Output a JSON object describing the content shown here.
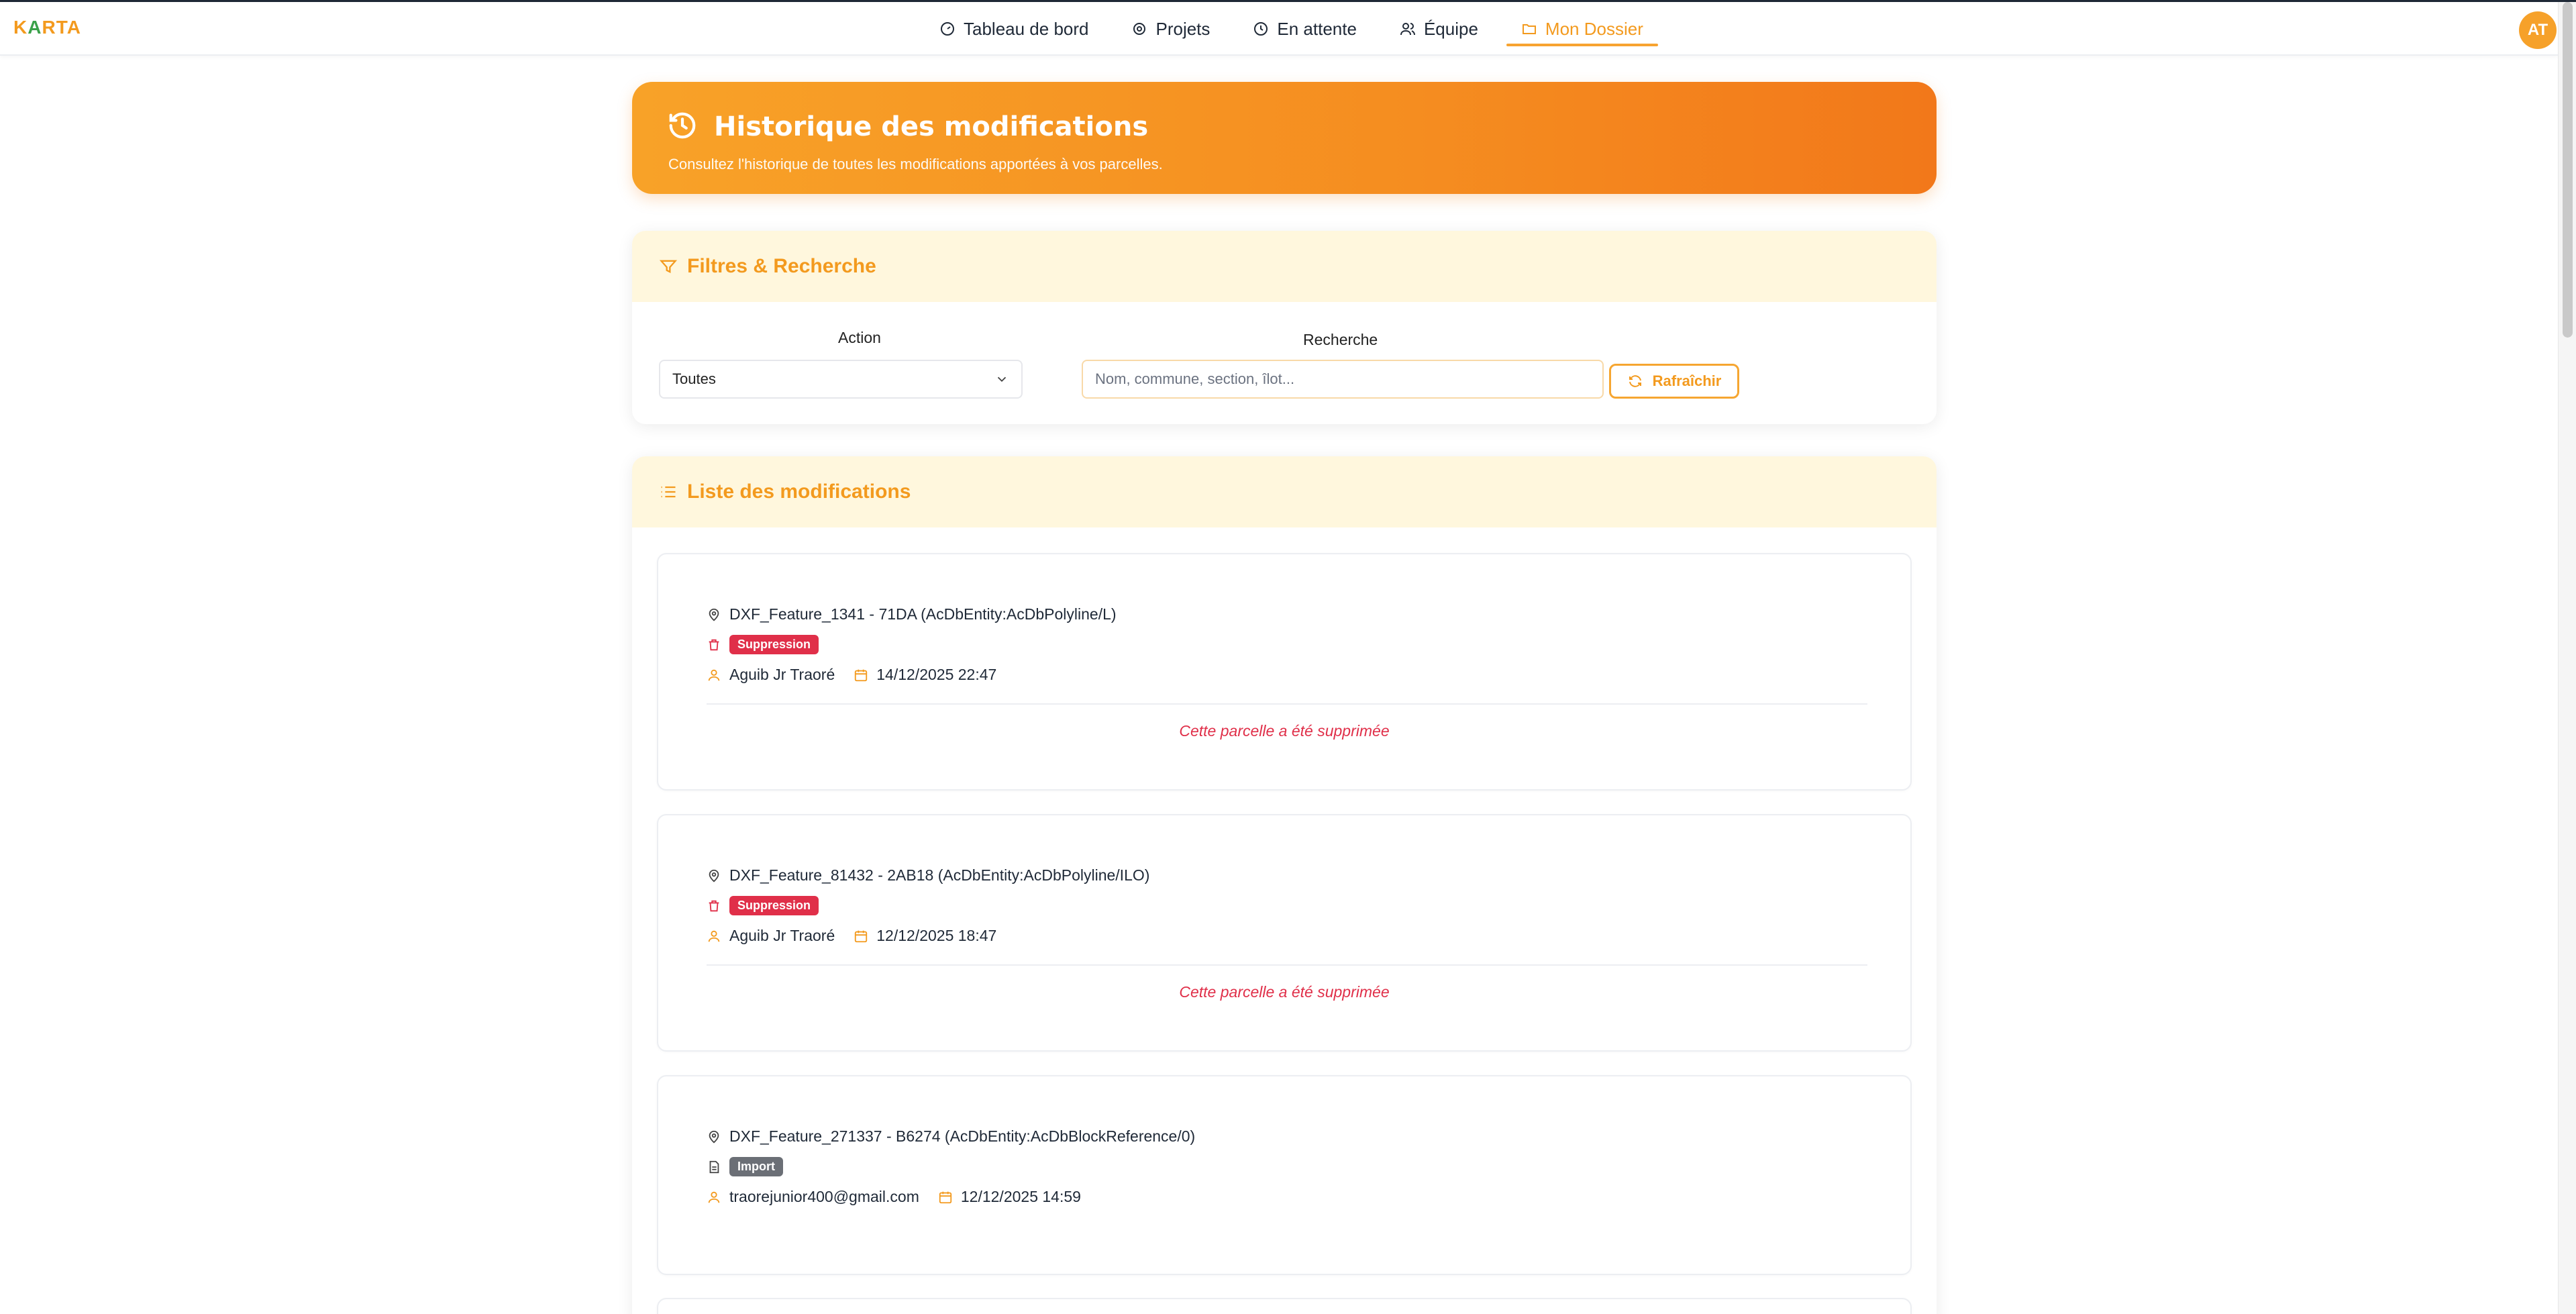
{
  "app": {
    "logo_pre": "K",
    "logo_mid": "A",
    "logo_post": "RTA",
    "avatar_initials": "AT"
  },
  "nav": [
    {
      "label": "Tableau de bord",
      "icon": "gauge-icon"
    },
    {
      "label": "Projets",
      "icon": "map-pin-icon"
    },
    {
      "label": "En attente",
      "icon": "clock-icon"
    },
    {
      "label": "Équipe",
      "icon": "users-icon"
    },
    {
      "label": "Mon Dossier",
      "icon": "folder-icon",
      "active": true
    }
  ],
  "hero": {
    "title": "Historique des modifications",
    "subtitle": "Consultez l'historique de toutes les modifications apportées à vos parcelles."
  },
  "filters": {
    "title": "Filtres & Recherche",
    "action_label": "Action",
    "action_value": "Toutes",
    "search_label": "Recherche",
    "search_placeholder": "Nom, commune, section, îlot...",
    "refresh_label": "Rafraîchir"
  },
  "list": {
    "title": "Liste des modifications",
    "items": [
      {
        "feature": "DXF_Feature_1341 - 71DA (AcDbEntity:AcDbPolyline/L)",
        "action": "Suppression",
        "user": "Aguib Jr Traoré",
        "date": "14/12/2025 22:47",
        "note": "Cette parcelle a été supprimée"
      },
      {
        "feature": "DXF_Feature_81432 - 2AB18 (AcDbEntity:AcDbPolyline/ILO)",
        "action": "Suppression",
        "user": "Aguib Jr Traoré",
        "date": "12/12/2025 18:47",
        "note": "Cette parcelle a été supprimée"
      },
      {
        "feature": "DXF_Feature_271337 - B6274 (AcDbEntity:AcDbBlockReference/0)",
        "action": "Import",
        "user": "traorejunior400@gmail.com",
        "date": "12/12/2025 14:59"
      }
    ]
  },
  "colors": {
    "accent": "#f39a1e",
    "danger": "#e02f49",
    "import": "#6b6f76",
    "soft": "#fff7dd"
  }
}
